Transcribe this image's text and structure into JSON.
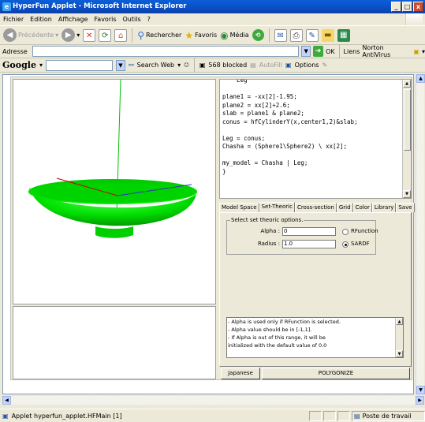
{
  "window": {
    "title": "HyperFun Applet - Microsoft Internet Explorer",
    "min_glyph": "_",
    "max_glyph": "□",
    "close_glyph": "x"
  },
  "menu": [
    "Fichier",
    "Edition",
    "Affichage",
    "Favoris",
    "Outils",
    "?"
  ],
  "toolbar": {
    "back_label": "Précédente",
    "search_label": "Rechercher",
    "favorites_label": "Favoris",
    "media_label": "Média"
  },
  "address": {
    "label": "Adresse",
    "go_label": "OK",
    "links_label": "Liens",
    "antivirus_label": "Norton AntiVirus"
  },
  "google": {
    "logo": "Google",
    "search_web_label": "Search Web",
    "blocked_label": "568 blocked",
    "autofill_label": "AutoFill",
    "options_label": "Options"
  },
  "code": {
    "text": "    Leg\n\nplane1 = -xx[2]-1.95;\nplane2 = xx[2]+2.6;\nslab = plane1 & plane2;\nconus = hfCylinderY(x,center1,2)&slab;\n\nLeg = conus;\nChasha = (Sphere1\\Sphere2) \\ xx[2];\n\nmy_model = Chasha | Leg;\n}"
  },
  "tabs": [
    "Model Space",
    "Set-Theoric",
    "Cross-section",
    "Grid",
    "Color",
    "Library",
    "Save"
  ],
  "settheoric": {
    "group_title": "Select set theoric options.",
    "alpha_label": "Alpha :",
    "alpha_value": "0",
    "radius_label": "Radius :",
    "radius_value": "1.0",
    "rfunction_label": "RFunction",
    "sardf_label": "SARDF"
  },
  "help": {
    "lines": [
      "- Alpha is used only if RFunction is selected.",
      "- Alpha value should be in [-1,1].",
      "- If Alpha is out of this range, it will be",
      "initialized with the default value of 0.0"
    ]
  },
  "buttons": {
    "japanese": "Japanese",
    "polygonize": "POLYGONIZE"
  },
  "status": {
    "text": "Applet hyperfun_applet.HFMain [1]",
    "zone": "Poste de travail"
  },
  "colors": {
    "model": "#00EE00",
    "axis_y": "#00C000",
    "axis_x": "#C00000",
    "axis_z": "#0000C0"
  }
}
